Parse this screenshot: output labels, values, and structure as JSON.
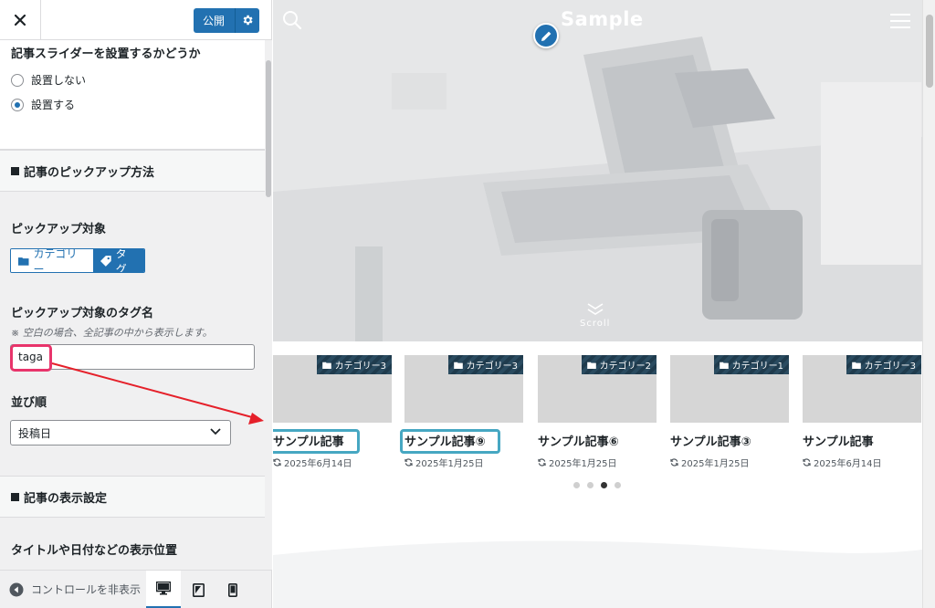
{
  "panel": {
    "publish_label": "公開",
    "slider_section": {
      "title": "記事スライダーを設置するかどうか",
      "options": [
        "設置しない",
        "設置する"
      ],
      "selected": "設置する"
    },
    "pickup_section": {
      "title": "記事のピックアップ方法",
      "target_label": "ピックアップ対象",
      "target_options": [
        "カテゴリー",
        "タグ"
      ],
      "target_selected": "タグ",
      "tag_name_label": "ピックアップ対象のタグ名",
      "tag_name_note": "※ 空白の場合、全記事の中から表示します。",
      "tag_name_value": "taga",
      "order_label": "並び順",
      "order_value": "投稿日"
    },
    "display_section": {
      "title": "記事の表示設定",
      "position_label": "タイトルや日付などの表示位置"
    },
    "footer": {
      "collapse_label": "コントロールを非表示"
    }
  },
  "preview": {
    "site_title": "Sample",
    "scroll_label": "Scroll",
    "cards": [
      {
        "category": "カテゴリー3",
        "title": "サンプル記事",
        "date": "2025年6月14日"
      },
      {
        "category": "カテゴリー3",
        "title": "サンプル記事⑨",
        "date": "2025年1月25日"
      },
      {
        "category": "カテゴリー2",
        "title": "サンプル記事⑥",
        "date": "2025年1月25日"
      },
      {
        "category": "カテゴリー1",
        "title": "サンプル記事③",
        "date": "2025年1月25日"
      },
      {
        "category": "カテゴリー3",
        "title": "サンプル記事",
        "date": "2025年6月14日"
      }
    ],
    "pager_dots": 4,
    "pager_active": 3
  },
  "colors": {
    "accent": "#2271b1",
    "category_badge": "#1f3b4d",
    "highlight_pink": "#e8346b",
    "highlight_teal": "#46a7c2",
    "arrow_red": "#e5202a"
  }
}
